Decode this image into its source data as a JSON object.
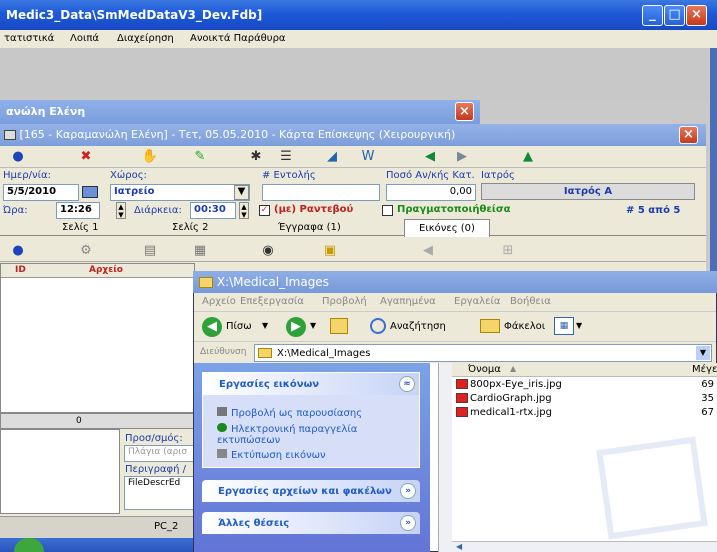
{
  "main_window": {
    "title": "Medic3_Data\\SmMedDataV3_Dev.Fdb]"
  },
  "main_menu": [
    "τατιστικά",
    "Λοιπά",
    "Διαχείρηση",
    "Ανοικτά Παράθυρα"
  ],
  "back_window": {
    "title": "ανώλη Ελένη"
  },
  "card_window": {
    "title": "[165 - Καραμανώλη Ελένη] - Τετ, 05.05.2010 - Κάρτα Επίσκεψης (Χειρουργική)",
    "labels": {
      "date": "Ημερ/νία:",
      "place": "Χώρος:",
      "order": "# Εντολής",
      "amount": "Ποσό Αν/κής Κατ.",
      "doctor": "Ιατρός",
      "time": "Ώρα:",
      "duration": "Διάρκεια:"
    },
    "date_value": "5/5/2010",
    "place_value": "Ιατρείο",
    "amount_value": "0,00",
    "doctor_value": "Ιατρός Α",
    "time_value": "12:26",
    "duration_value": "00:30",
    "appointment_check": "(με) Ραντεβού",
    "realized_check": "Πραγματοποιήθείσα",
    "counter": "# 5 από 5",
    "tabs": [
      "Σελίς 1",
      "Σελίς 2",
      "Έγγραφα (1)",
      "Εικόνες (0)"
    ],
    "grid_headers": [
      "ID",
      "Αρχείο"
    ],
    "count_value": "0",
    "sub_label": "Προσ/σμός:",
    "sub_placeholder": "Πλάγια (αρισ",
    "desc_label": "Περιγραφή /",
    "desc_value": "FileDescrEd"
  },
  "statusbar": {
    "pc": "PC_2"
  },
  "explorer": {
    "title": "X:\\Medical_Images",
    "menu": [
      "Αρχείο",
      "Επεξεργασία",
      "Προβολή",
      "Αγαπημένα",
      "Εργαλεία",
      "Βοήθεια"
    ],
    "toolbar": {
      "back": "Πίσω",
      "search": "Αναζήτηση",
      "folders": "Φάκελοι"
    },
    "address_label": "Διεύθυνση",
    "address_value": "X:\\Medical_Images",
    "side": {
      "image_tasks": "Εργασίες εικόνων",
      "image_task_items": [
        "Προβολή ως παρουσίασης",
        "Ηλεκτρονική παραγγελία εκτυπώσεων",
        "Εκτύπωση εικόνων"
      ],
      "file_tasks": "Εργασίες αρχείων και φακέλων",
      "other_places": "Άλλες θέσεις"
    },
    "columns": {
      "name": "Όνομα",
      "size": "Μέγεθ"
    },
    "files": [
      {
        "name": "800px-Eye_iris.jpg",
        "size": "69"
      },
      {
        "name": "CardioGraph.jpg",
        "size": "35"
      },
      {
        "name": "medical1-rtx.jpg",
        "size": "67"
      }
    ]
  }
}
